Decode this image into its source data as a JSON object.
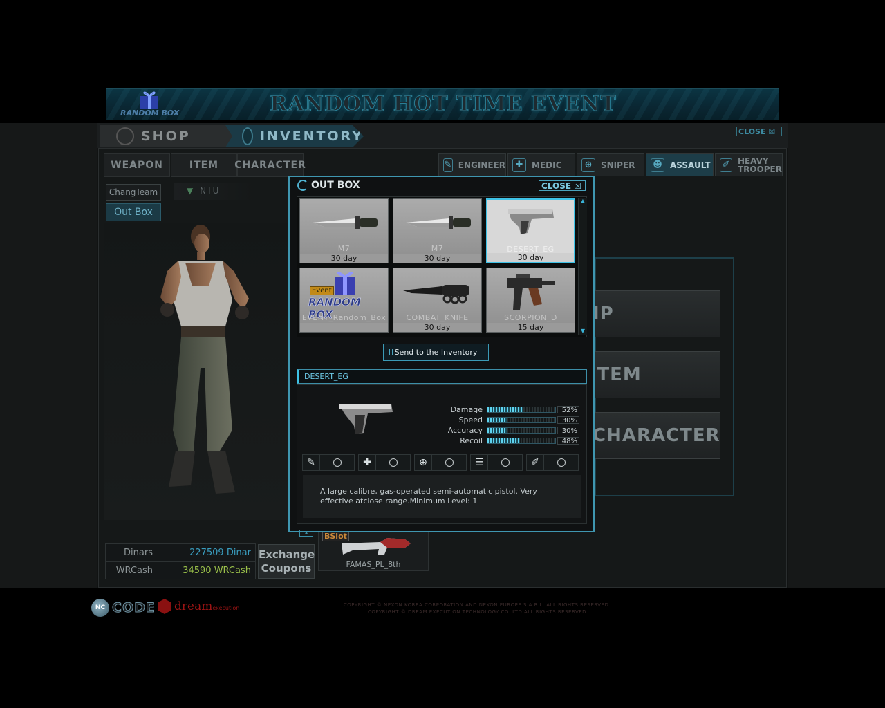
{
  "banner": {
    "title": "RANDOM HOT TIME EVENT",
    "badge": "RANDOM BOX",
    "badge_event": "Event"
  },
  "nav": {
    "shop": "SHOP",
    "inventory": "INVENTORY",
    "close": "CLOSE"
  },
  "categories": {
    "weapon": "WEAPON",
    "item": "ITEM",
    "character": "CHARACTER"
  },
  "classes": {
    "engineer": "ENGINEER",
    "medic": "MEDIC",
    "sniper": "SNIPER",
    "assault": "ASSAULT",
    "heavy_1": "HEAVY",
    "heavy_2": "TROOPER"
  },
  "player": {
    "clan": "ChangTeam",
    "name": "NIU",
    "outbox": "Out Box"
  },
  "money": {
    "dinar_label": "Dinars",
    "dinar_value": "227509 Dinar",
    "dinar_color": "#3a9ec0",
    "wrcash_label": "WRCash",
    "wrcash_value": "34590 WRCash",
    "wrcash_color": "#9ac04a"
  },
  "exchange": {
    "line1": "Exchange",
    "line2": "Coupons"
  },
  "bslot": {
    "tag": "BSlot",
    "name": "FAMAS_PL_8th"
  },
  "right_buttons": {
    "equip": "EQUIP",
    "item": "SELECT ITEM",
    "character": "CHARACTER"
  },
  "outbox": {
    "title": "OUT BOX",
    "close": "CLOSE",
    "items": [
      {
        "name": "M7",
        "duration": "30 day",
        "icon": "knife-icon"
      },
      {
        "name": "M7",
        "duration": "30 day",
        "icon": "knife-icon"
      },
      {
        "name": "DESERT_EG",
        "duration": "30 day",
        "icon": "pistol-icon",
        "selected": true
      },
      {
        "name": "EVENT_Random_Box",
        "duration": "",
        "icon": "gift-box-icon",
        "badge": "Event",
        "logo": "RANDOM BOX"
      },
      {
        "name": "COMBAT_KNIFE",
        "duration": "30 day",
        "icon": "combat-knife-icon"
      },
      {
        "name": "SCORPION_D",
        "duration": "15 day",
        "icon": "smg-icon"
      }
    ],
    "send_button": "Send to the Inventory",
    "selected_name": "DESERT_EG",
    "stats": [
      {
        "label": "Damage",
        "value": 52,
        "text": "52%"
      },
      {
        "label": "Speed",
        "value": 30,
        "text": "30%"
      },
      {
        "label": "Accuracy",
        "value": 30,
        "text": "30%"
      },
      {
        "label": "Recoil",
        "value": 48,
        "text": "48%"
      }
    ],
    "class_slots": [
      {
        "icon": "wrench-icon",
        "glyph": "✎"
      },
      {
        "icon": "medic-cross-icon",
        "glyph": "✚"
      },
      {
        "icon": "crosshair-icon",
        "glyph": "⊕"
      },
      {
        "icon": "assault-bars-icon",
        "glyph": "☰"
      },
      {
        "icon": "heavy-icon",
        "glyph": "✐"
      }
    ],
    "description": "A large calibre, gas-operated semi-automatic pistol. Very effective atclose range.Minimum Level: 1"
  },
  "footer": {
    "logo1_badge": "NC",
    "logo1_text": "CODE",
    "logo2_text": "dream",
    "logo2_sub": "execution",
    "copyright_1": "COPYRIGHT © NEXON KOREA CORPORATION AND NEXON EUROPE S.A.R.L. ALL RIGHTS RESERVED.",
    "copyright_2": "COPYRIGHT © DREAM EXECUTION TECHNOLOGY CO. LTD ALL RIGHTS RESERVED"
  }
}
